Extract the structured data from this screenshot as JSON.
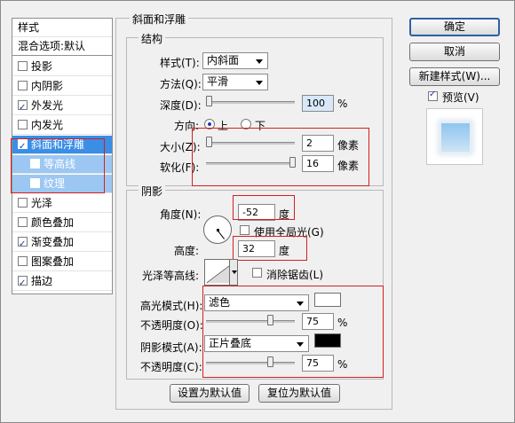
{
  "sidebar": {
    "header": "样式",
    "blend_default": "混合选项:默认",
    "items": [
      {
        "label": "投影",
        "checked": false
      },
      {
        "label": "内阴影",
        "checked": false
      },
      {
        "label": "外发光",
        "checked": true
      },
      {
        "label": "内发光",
        "checked": false
      },
      {
        "label": "斜面和浮雕",
        "checked": true,
        "selected": true
      },
      {
        "label": "等高线",
        "checked": false,
        "sub": true
      },
      {
        "label": "纹理",
        "checked": false,
        "sub": true
      },
      {
        "label": "光泽",
        "checked": false
      },
      {
        "label": "颜色叠加",
        "checked": false
      },
      {
        "label": "渐变叠加",
        "checked": true
      },
      {
        "label": "图案叠加",
        "checked": false
      },
      {
        "label": "描边",
        "checked": true
      }
    ]
  },
  "bevel": {
    "section_title": "斜面和浮雕",
    "structure_title": "结构",
    "style_label": "样式(T):",
    "style_value": "内斜面",
    "technique_label": "方法(Q):",
    "technique_value": "平滑",
    "depth_label": "深度(D):",
    "depth_value": "100",
    "depth_unit": "%",
    "direction_label": "方向:",
    "direction_up": "上",
    "direction_down": "下",
    "size_label": "大小(Z):",
    "size_value": "2",
    "size_unit": "像素",
    "soften_label": "软化(F):",
    "soften_value": "16",
    "soften_unit": "像素"
  },
  "shading": {
    "title": "阴影",
    "angle_label": "角度(N):",
    "angle_value": "-52",
    "angle_unit": "度",
    "global_light_label": "使用全局光(G)",
    "altitude_label": "高度:",
    "altitude_value": "32",
    "altitude_unit": "度",
    "gloss_label": "光泽等高线:",
    "antialias_label": "消除锯齿(L)",
    "highlight_mode_label": "高光模式(H):",
    "highlight_mode_value": "滤色",
    "highlight_opacity_label": "不透明度(O):",
    "highlight_opacity_value": "75",
    "shadow_mode_label": "阴影模式(A):",
    "shadow_mode_value": "正片叠底",
    "shadow_opacity_label": "不透明度(C):",
    "shadow_opacity_value": "75",
    "percent": "%"
  },
  "footer": {
    "make_default": "设置为默认值",
    "reset_default": "复位为默认值"
  },
  "buttons": {
    "ok": "确定",
    "cancel": "取消",
    "new_style": "新建样式(W)...",
    "preview": "预览(V)"
  },
  "colors": {
    "accent": "#3a8ee6",
    "highlight_color": "#ffffff",
    "shadow_color": "#000000",
    "annotation_red": "#d41f1f"
  },
  "sliders": {
    "depth_fraction": 0.0,
    "size_fraction": 0.0,
    "soften_fraction": 1.0,
    "highlight_opacity_fraction": 0.75,
    "shadow_opacity_fraction": 0.75
  }
}
